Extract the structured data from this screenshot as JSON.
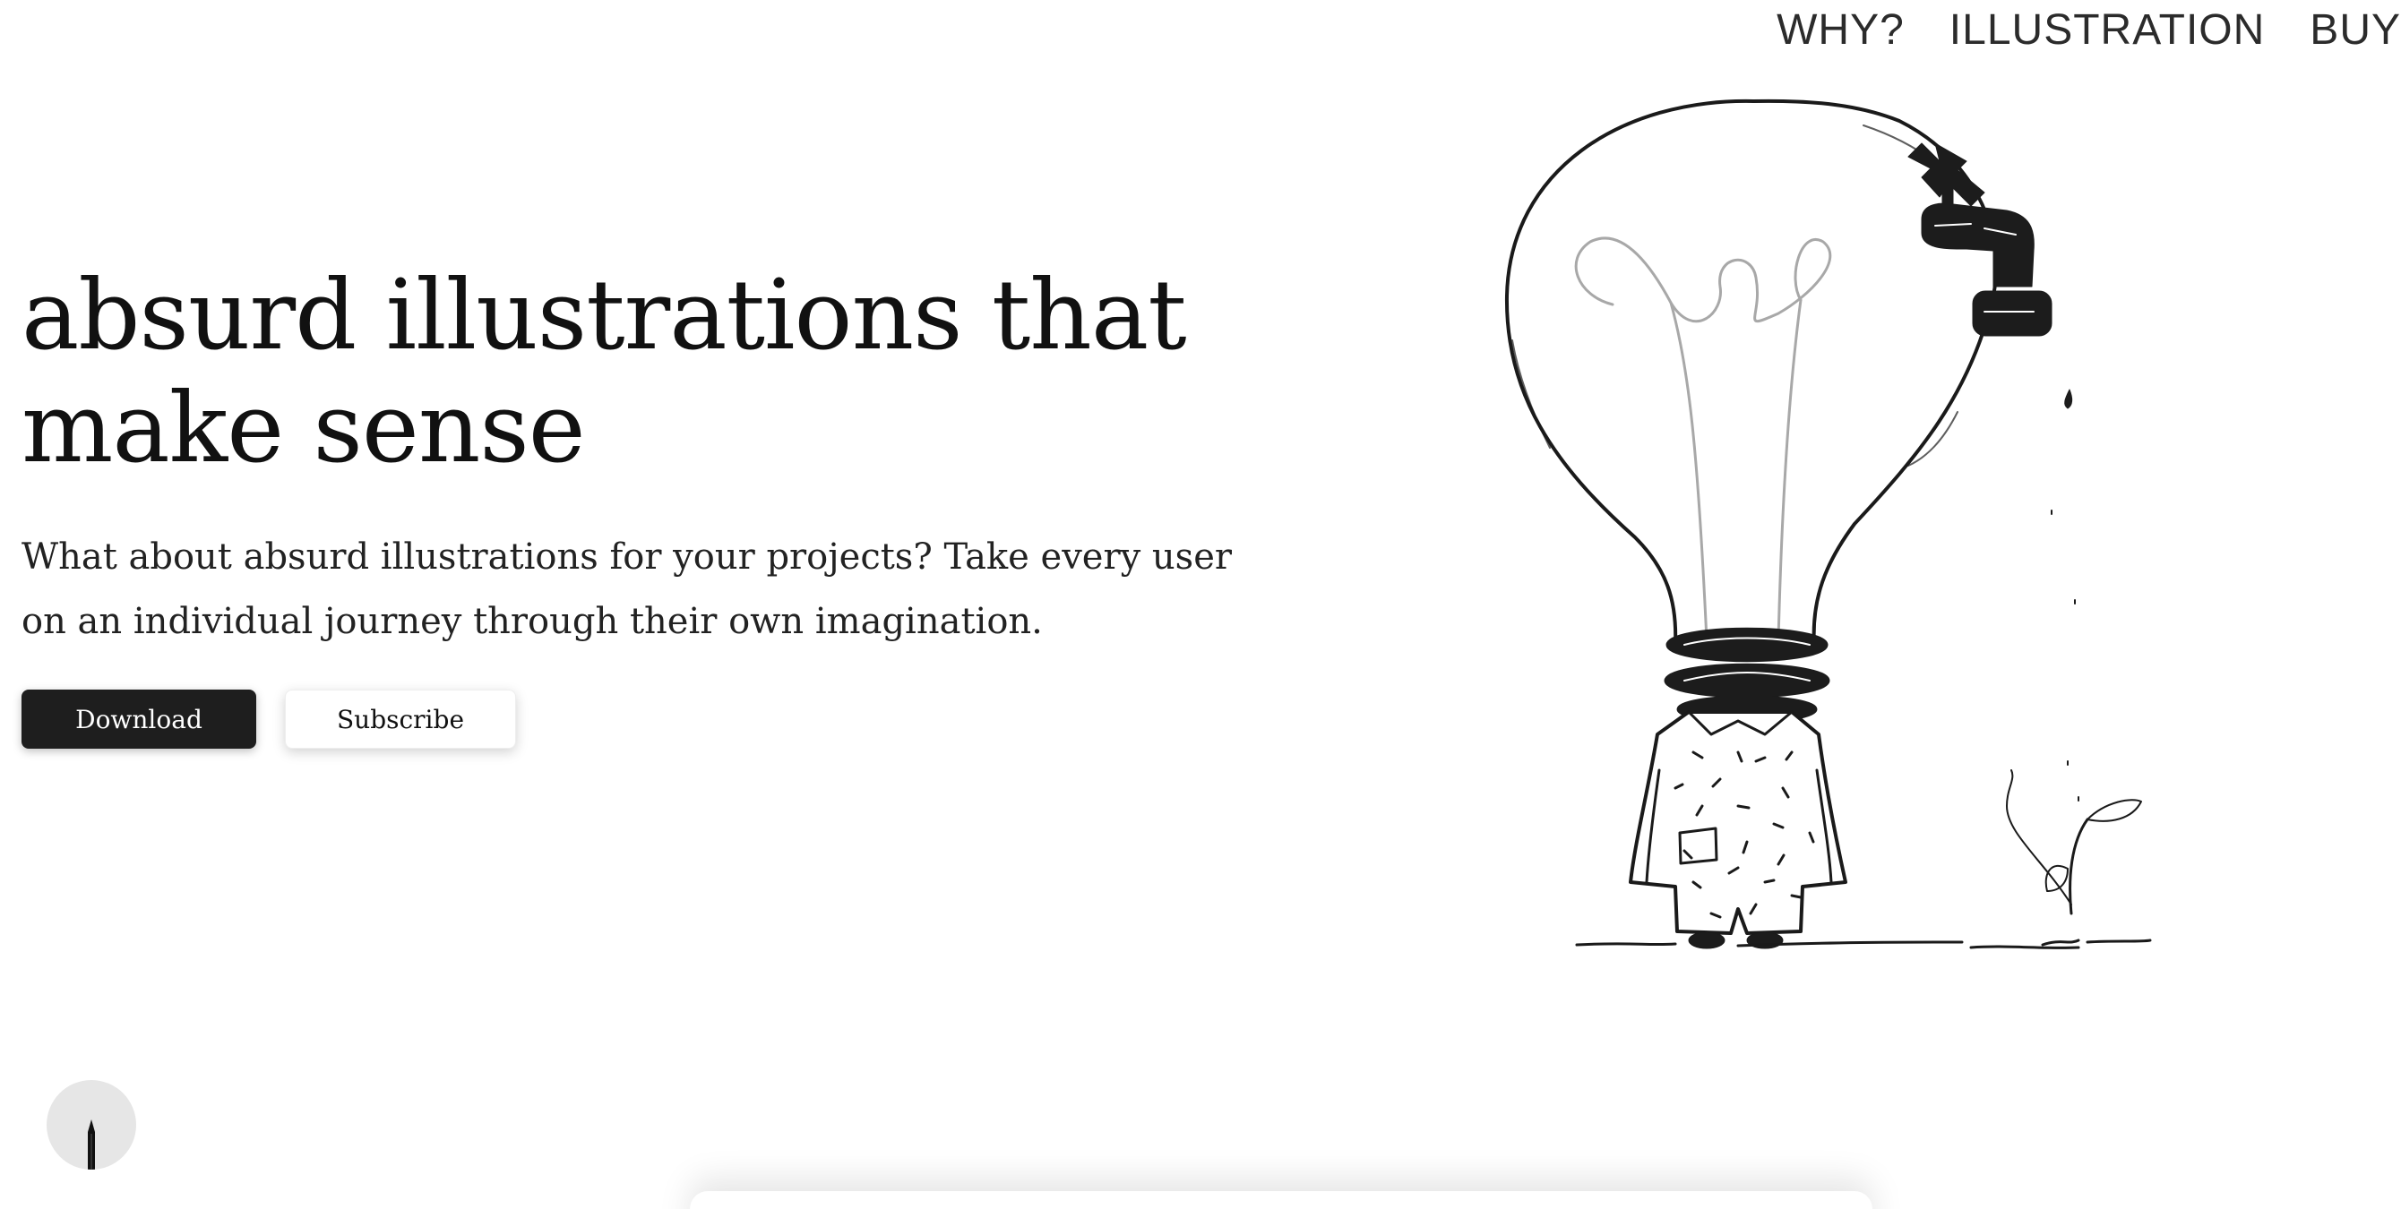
{
  "nav": {
    "items": [
      {
        "label": "WHY?"
      },
      {
        "label": "ILLUSTRATION"
      },
      {
        "label": "BUY"
      }
    ]
  },
  "hero": {
    "title": "absurd illustrations that make sense",
    "subtitle": "What about absurd illustrations for your projects? Take every user on an individual journey through their own imagination.",
    "download_label": "Download",
    "subscribe_label": "Subscribe"
  },
  "illustration": {
    "subject": "lightbulb-headed figure with faucet watering a sprout"
  },
  "fab": {
    "icon": "pencil-icon"
  },
  "colors": {
    "primary_button": "#1e1e1e",
    "text": "#111111",
    "fab_background": "#e6e6e6"
  }
}
